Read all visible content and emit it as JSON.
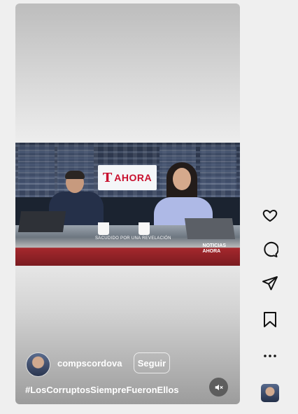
{
  "post": {
    "username": "compscordova",
    "follow_label": "Seguir",
    "caption": "#LosCorruptosSiempreFueronEllos"
  },
  "video": {
    "logo_t": "T",
    "logo_text": "AHORA",
    "lower_third": "SACUDIDO POR UNA REVELACIÓN",
    "corner_logo_line1": "NOTICIAS",
    "corner_logo_line2": "AHORA"
  },
  "actions": [
    "heart-icon",
    "comment-icon",
    "share-icon",
    "bookmark-icon",
    "more-icon"
  ],
  "colors": {
    "accent": "#c8102e",
    "background": "#efefef"
  }
}
